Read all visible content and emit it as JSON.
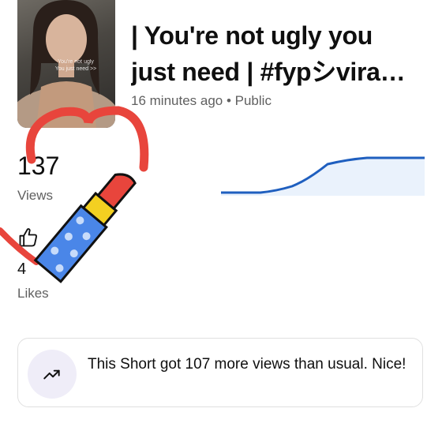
{
  "short": {
    "title_line1": "| You're not ugly you",
    "title_line2": "just need | #fypシvira…",
    "meta": "16 minutes ago • Public",
    "thumbnail_overlay": "You're not ugly\nYou just need >>"
  },
  "stats": {
    "views_value": "137",
    "views_label": "Views",
    "likes_value": "4",
    "likes_label": "Likes"
  },
  "trend": {
    "message": "This Short got 107 more views than usual. Nice!",
    "icon": "trending-up-icon"
  },
  "colors": {
    "chart_line": "#1f5fbf",
    "chart_fill": "#eaf2fc",
    "heart_sticker": "#e8453c",
    "lipstick_case": "#4a86e8",
    "lipstick_band": "#f3d021",
    "lipstick_tip": "#e8453c"
  }
}
